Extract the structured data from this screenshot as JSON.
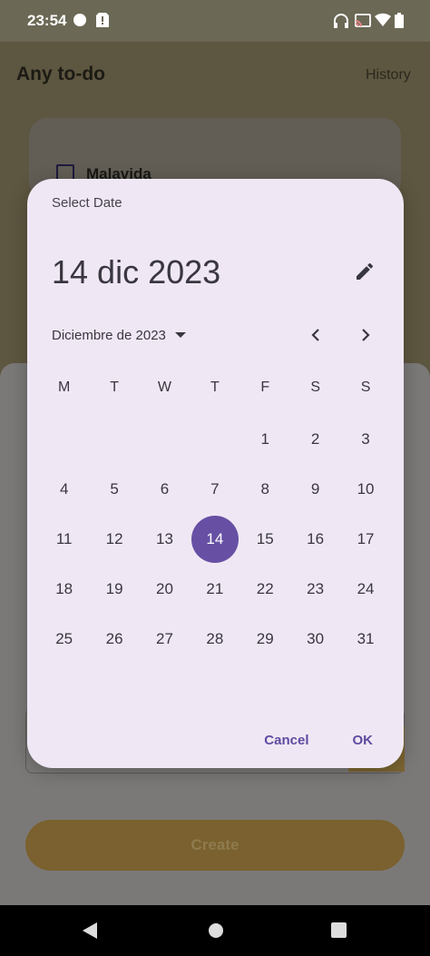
{
  "status_bar": {
    "time": "23:54"
  },
  "app": {
    "title": "Any to-do",
    "history_label": "History",
    "todo_item": "Malavida",
    "create_label": "Create"
  },
  "date_picker": {
    "heading": "Select Date",
    "selected_date": "14 dic 2023",
    "month_label": "Diciembre de 2023",
    "weekdays": [
      "M",
      "T",
      "W",
      "T",
      "F",
      "S",
      "S"
    ],
    "leading_blanks": 4,
    "days": [
      "1",
      "2",
      "3",
      "4",
      "5",
      "6",
      "7",
      "8",
      "9",
      "10",
      "11",
      "12",
      "13",
      "14",
      "15",
      "16",
      "17",
      "18",
      "19",
      "20",
      "21",
      "22",
      "23",
      "24",
      "25",
      "26",
      "27",
      "28",
      "29",
      "30",
      "31"
    ],
    "selected_day": "14",
    "cancel_label": "Cancel",
    "ok_label": "OK"
  },
  "colors": {
    "accent": "#6750a4",
    "dialog_bg": "#efe8f4"
  }
}
